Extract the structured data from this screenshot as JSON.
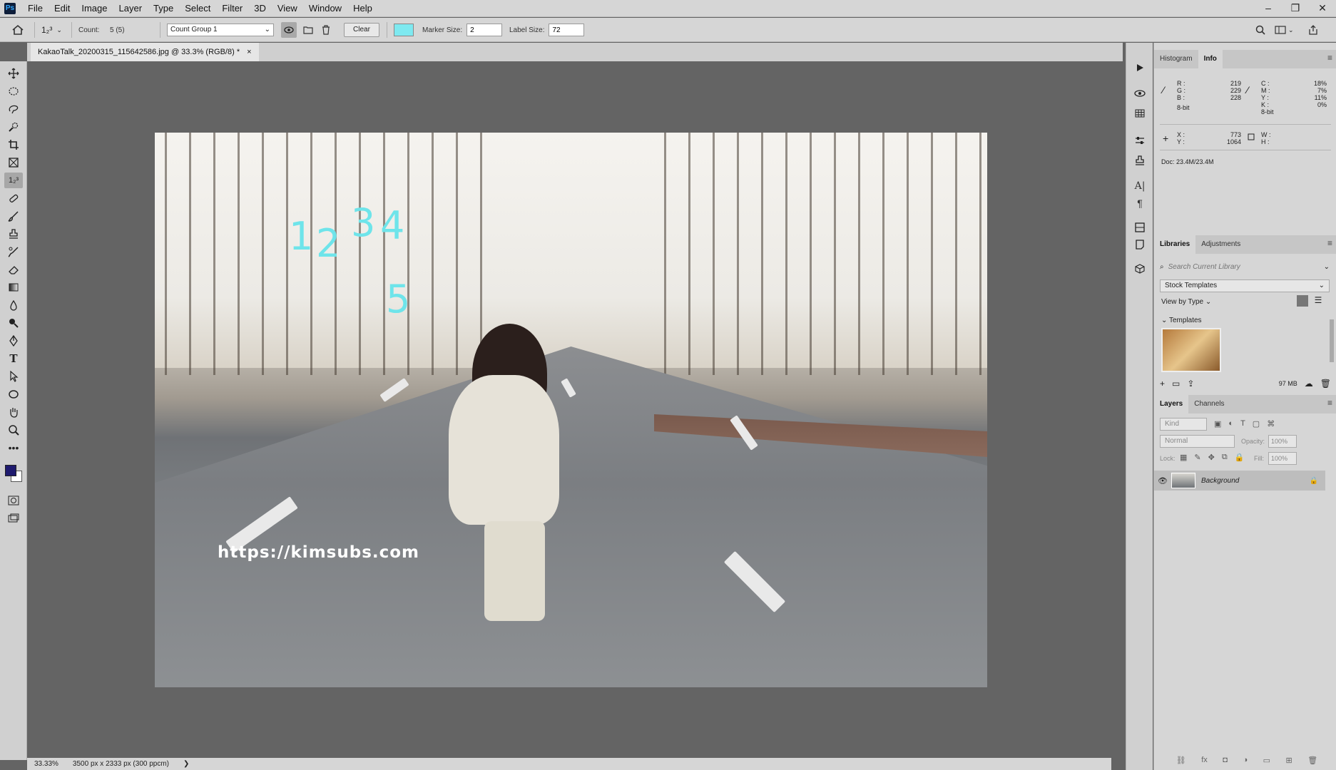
{
  "menu": [
    "File",
    "Edit",
    "Image",
    "Layer",
    "Type",
    "Select",
    "Filter",
    "3D",
    "View",
    "Window",
    "Help"
  ],
  "app": {
    "logo": "Ps"
  },
  "window_controls": {
    "minimize": "–",
    "restore": "❐",
    "close": "✕"
  },
  "options": {
    "tool_glyph": "1₂³",
    "count_label": "Count:",
    "count_value": "5 (5)",
    "count_group": "Count Group 1",
    "clear_label": "Clear",
    "marker_color": "#7ee9f0",
    "marker_size_label": "Marker Size:",
    "marker_size": "2",
    "label_size_label": "Label Size:",
    "label_size": "72"
  },
  "document": {
    "tab_title": "KakaoTalk_20200315_115642586.jpg @ 33.3% (RGB/8) *",
    "close": "×",
    "watermark": "https://kimsubs.com"
  },
  "count_markers": [
    "1",
    "2",
    "3",
    "4",
    "5"
  ],
  "status": {
    "zoom": "33.33%",
    "dims": "3500 px x 2333 px (300 ppcm)",
    "arrow": "❯"
  },
  "info_panel": {
    "tabs": [
      "Histogram",
      "Info"
    ],
    "rgb": {
      "r_label": "R :",
      "r": "219",
      "g_label": "G :",
      "g": "229",
      "b_label": "B :",
      "b": "228",
      "bit": "8-bit"
    },
    "cmyk": {
      "c_label": "C :",
      "c": "18%",
      "m_label": "M :",
      "m": "7%",
      "y_label": "Y :",
      "y": "11%",
      "k_label": "K :",
      "k": "0%",
      "bit": "8-bit"
    },
    "xy": {
      "x_label": "X :",
      "x": "773",
      "y_label": "Y :",
      "y": "1064"
    },
    "wh": {
      "w_label": "W :",
      "h_label": "H :"
    },
    "doc": "Doc: 23.4M/23.4M"
  },
  "libraries": {
    "tabs": [
      "Libraries",
      "Adjustments"
    ],
    "search_placeholder": "Search Current Library",
    "library": "Stock Templates",
    "view": "View by Type",
    "section": "Templates",
    "size": "97 MB"
  },
  "layers": {
    "tabs": [
      "Layers",
      "Channels"
    ],
    "kind": "Kind",
    "blend": "Normal",
    "opacity_label": "Opacity:",
    "opacity": "100%",
    "lock_label": "Lock:",
    "fill_label": "Fill:",
    "fill": "100%",
    "layer_name": "Background"
  }
}
